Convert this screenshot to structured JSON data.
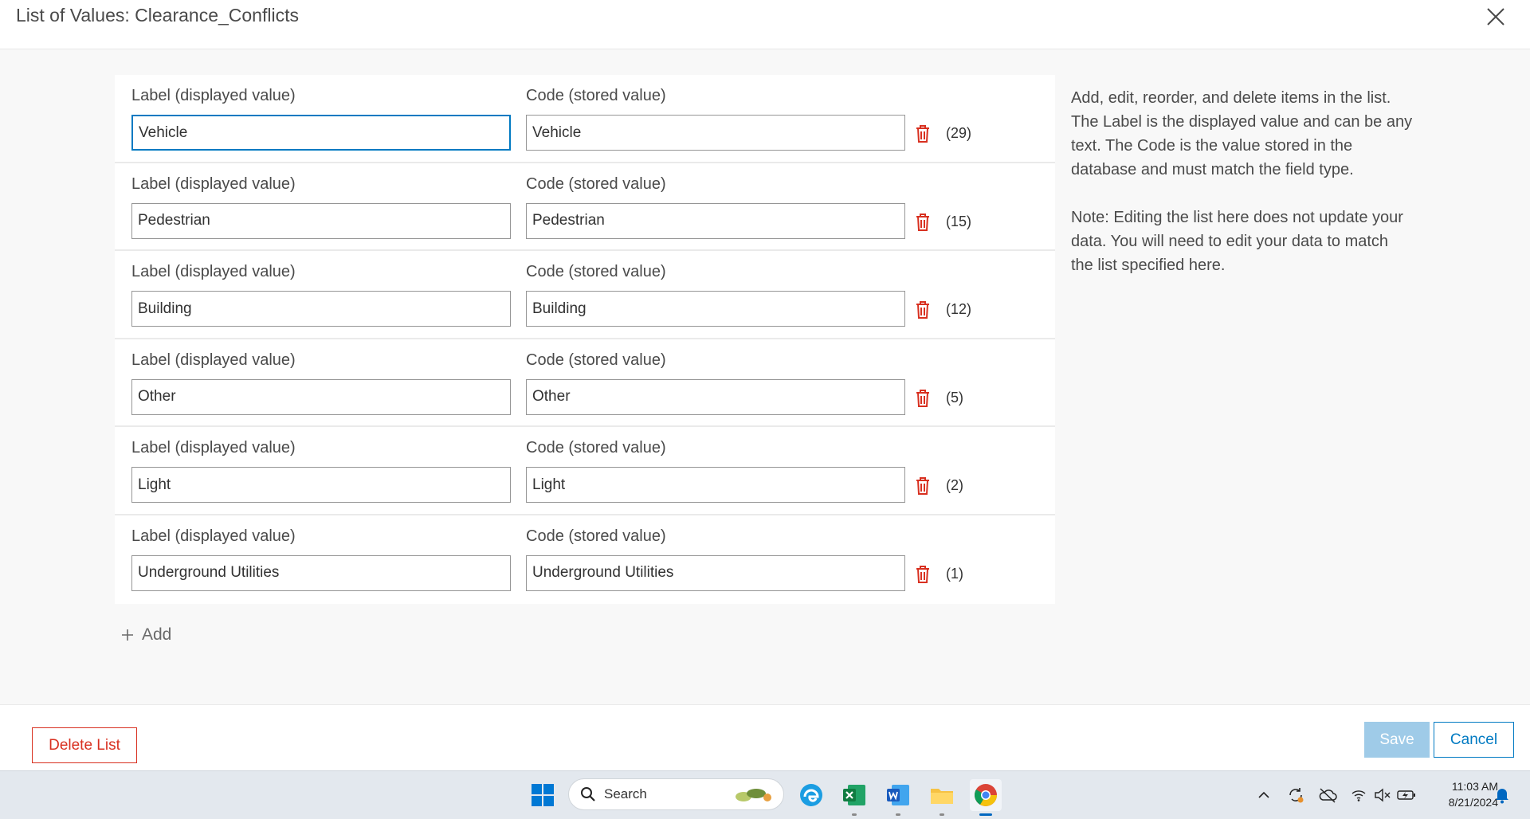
{
  "dialog": {
    "title": "List of Values: Clearance_Conflicts",
    "close_icon": "close-icon"
  },
  "list": {
    "label_header": "Label (displayed value)",
    "code_header": "Code (stored value)",
    "items": [
      {
        "label": "Vehicle",
        "code": "Vehicle",
        "count": "(29)"
      },
      {
        "label": "Pedestrian",
        "code": "Pedestrian",
        "count": "(15)"
      },
      {
        "label": "Building",
        "code": "Building",
        "count": "(12)"
      },
      {
        "label": "Other",
        "code": "Other",
        "count": "(5)"
      },
      {
        "label": "Light",
        "code": "Light",
        "count": "(2)"
      },
      {
        "label": "Underground Utilities",
        "code": "Underground Utilities",
        "count": "(1)"
      }
    ],
    "add_label": "Add"
  },
  "help": {
    "paragraph1": "Add, edit, reorder, and delete items in the list. The Label is the displayed value and can be any text. The Code is the value stored in the database and must match the field type.",
    "paragraph2": "Note: Editing the list here does not update your data. You will need to edit your data to match the list specified here."
  },
  "footer": {
    "delete_list": "Delete List",
    "save": "Save",
    "cancel": "Cancel"
  },
  "taskbar": {
    "search_placeholder": "Search",
    "time": "11:03 AM",
    "date": "8/21/2024"
  },
  "colors": {
    "accent": "#007ac2",
    "danger": "#d83020",
    "save_disabled": "#9fcbe8"
  }
}
